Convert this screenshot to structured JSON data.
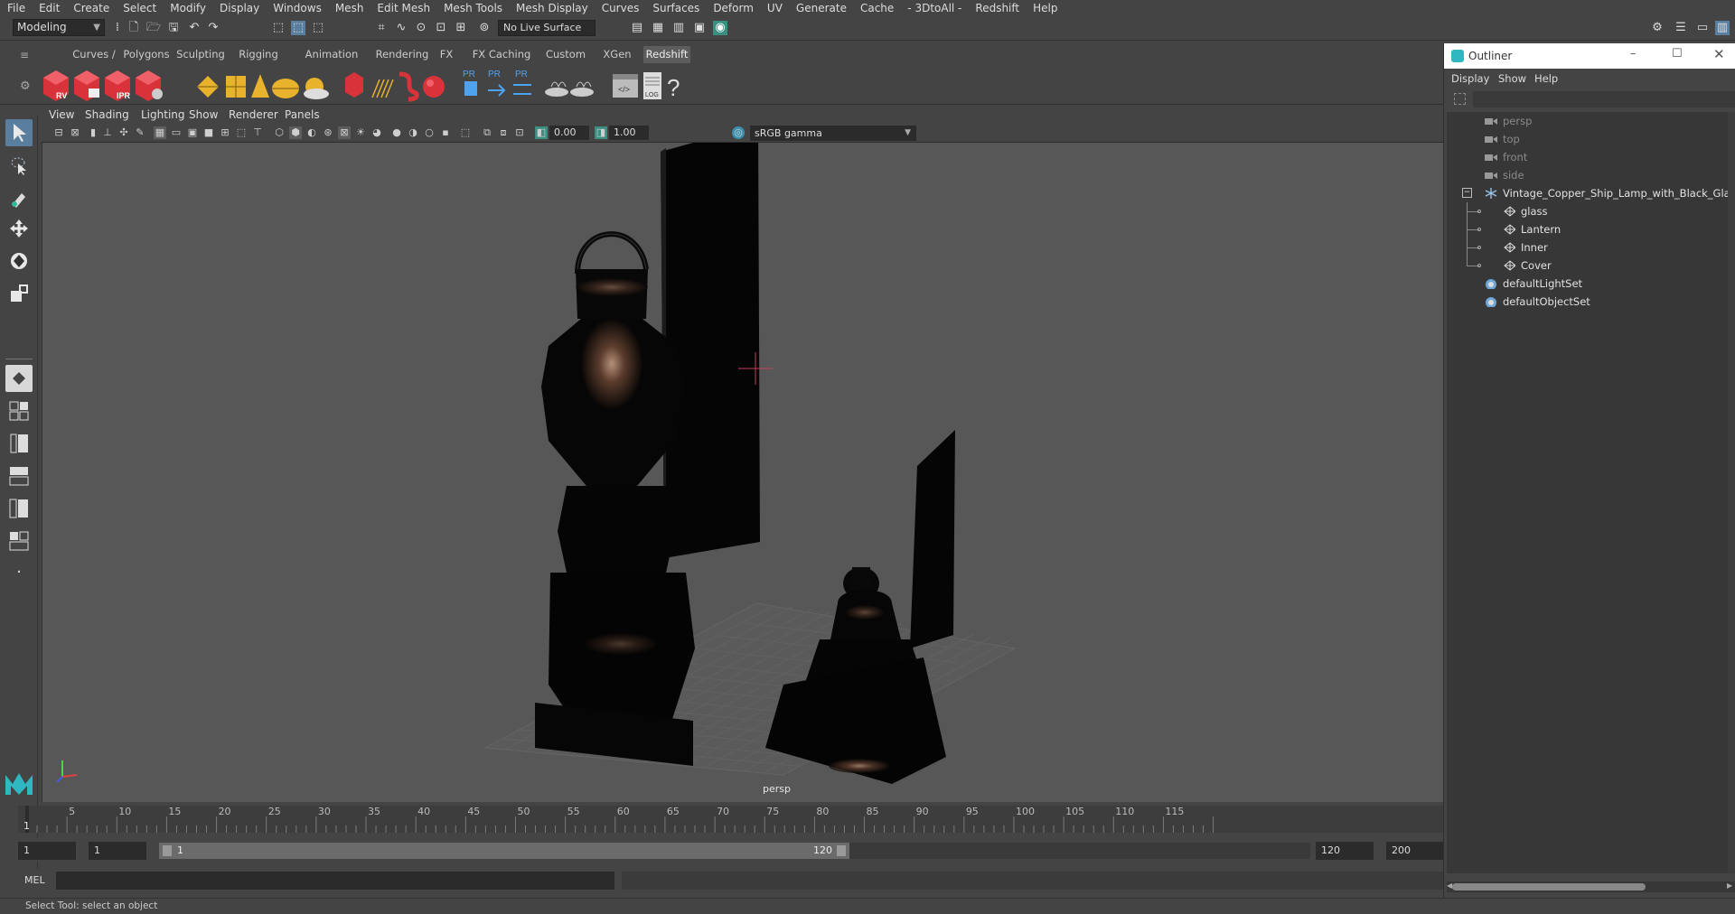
{
  "menubar": {
    "items": [
      "File",
      "Edit",
      "Create",
      "Select",
      "Modify",
      "Display",
      "Windows",
      "Mesh",
      "Edit Mesh",
      "Mesh Tools",
      "Mesh Display",
      "Curves",
      "Surfaces",
      "Deform",
      "UV",
      "Generate",
      "Cache",
      "- 3DtoAll -",
      "Redshift",
      "Help"
    ]
  },
  "statusline": {
    "mode": "Modeling",
    "live_surface": "No Live Surface"
  },
  "shelf": {
    "tabs": [
      "Curves / Surfaces",
      "Polygons",
      "Sculpting",
      "Rigging",
      "Animation",
      "Rendering",
      "FX",
      "FX Caching",
      "Custom",
      "XGen",
      "Redshift"
    ],
    "active_tab": "Redshift",
    "icon_labels": {
      "rv": "RV",
      "ipr": "IPR",
      "pr1": "PR",
      "pr2": "PR",
      "pr3": "PR",
      "log": "LOG"
    }
  },
  "viewport": {
    "menu": [
      "View",
      "Shading",
      "Lighting",
      "Show",
      "Renderer",
      "Panels"
    ],
    "exposure": "0.00",
    "gamma": "1.00",
    "color_space": "sRGB gamma",
    "camera_label": "persp"
  },
  "timeline": {
    "ticks": [
      1,
      5,
      10,
      15,
      20,
      25,
      30,
      35,
      40,
      45,
      50,
      55,
      60,
      65,
      70,
      75,
      80,
      85,
      90,
      95,
      100,
      105,
      110,
      115
    ],
    "current_frame": "1",
    "min_frame": 1,
    "max_frame": 120
  },
  "range": {
    "start": "1",
    "anim_start": "1",
    "range_start": "1",
    "range_end": "120",
    "end": "120",
    "anim_end": "200"
  },
  "command": {
    "lang": "MEL"
  },
  "help_line": "Select Tool: select an object",
  "outliner": {
    "title": "Outliner",
    "menu": [
      "Display",
      "Show",
      "Help"
    ],
    "rows": [
      {
        "label": "persp",
        "kind": "camera",
        "dim": true,
        "indent": 0
      },
      {
        "label": "top",
        "kind": "camera",
        "dim": true,
        "indent": 0
      },
      {
        "label": "front",
        "kind": "camera",
        "dim": true,
        "indent": 0
      },
      {
        "label": "side",
        "kind": "camera",
        "dim": true,
        "indent": 0
      },
      {
        "label": "Vintage_Copper_Ship_Lamp_with_Black_Glass_D",
        "kind": "group",
        "dim": false,
        "indent": 0
      },
      {
        "label": "glass",
        "kind": "mesh",
        "dim": false,
        "indent": 1
      },
      {
        "label": "Lantern",
        "kind": "mesh",
        "dim": false,
        "indent": 1
      },
      {
        "label": "Inner",
        "kind": "mesh",
        "dim": false,
        "indent": 1
      },
      {
        "label": "Cover",
        "kind": "mesh",
        "dim": false,
        "indent": 1
      },
      {
        "label": "defaultLightSet",
        "kind": "set",
        "dim": false,
        "indent": 0
      },
      {
        "label": "defaultObjectSet",
        "kind": "set",
        "dim": false,
        "indent": 0
      }
    ]
  },
  "colors": {
    "accent": "#5a7f9e",
    "redshift_red": "#d8323a",
    "shelf_yellow": "#e9b22c",
    "viewport_bg": "#575757"
  }
}
